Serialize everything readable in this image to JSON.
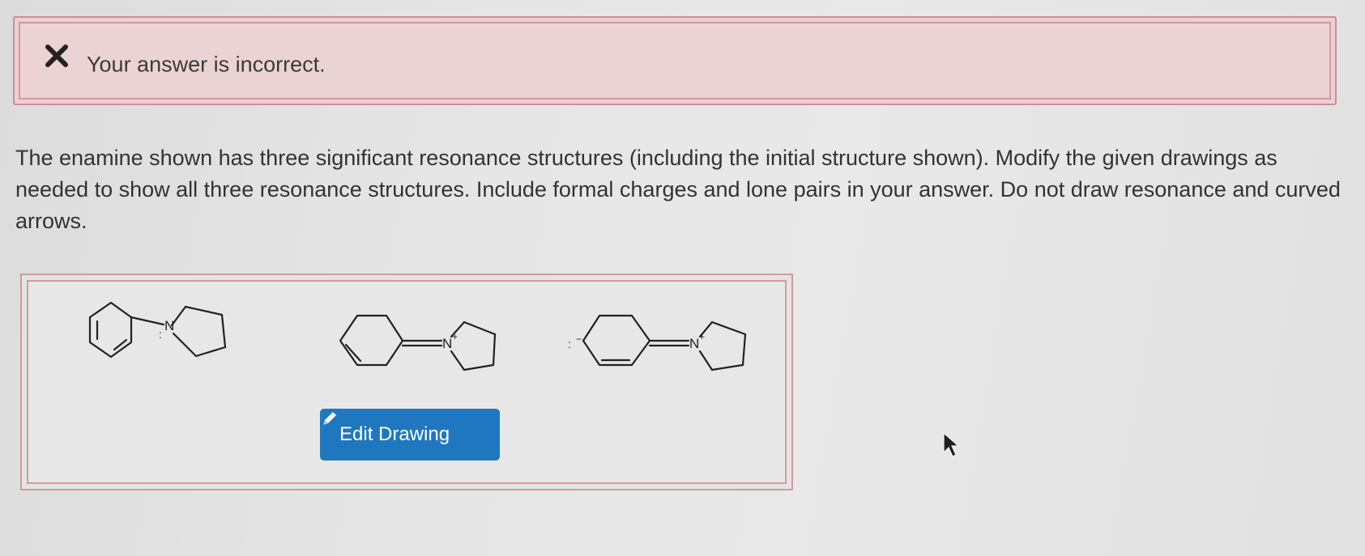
{
  "feedback": {
    "icon": "x-icon",
    "message": "Your answer is incorrect.",
    "status_color": "#c98f98"
  },
  "question": {
    "text": "The enamine shown has three significant resonance structures (including the initial structure shown). Modify the given drawings as needed to show all three resonance structures. Include formal charges and lone pairs in your answer. Do not draw resonance and curved arrows."
  },
  "drawing": {
    "structures": [
      {
        "atom": "N",
        "charge": "",
        "lone_pair": ":"
      },
      {
        "atom": "N",
        "charge": "+",
        "lone_pair": ""
      },
      {
        "atom": "N",
        "charge": "+",
        "lone_pair": ":",
        "carbanion_charge": "−"
      }
    ],
    "edit_button": {
      "label": "Edit Drawing",
      "icon": "pencil-icon",
      "color": "#1f78bf"
    }
  }
}
